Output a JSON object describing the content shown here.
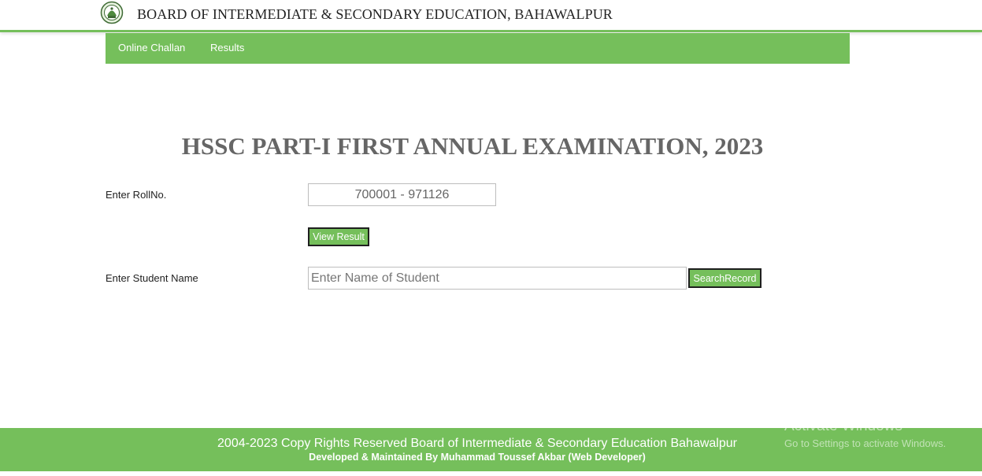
{
  "header": {
    "board_name": "BOARD OF INTERMEDIATE & SECONDARY EDUCATION, BAHAWALPUR",
    "logo_icon": "board-seal-icon"
  },
  "nav": {
    "items": [
      {
        "label": "Online Challan"
      },
      {
        "label": "Results"
      }
    ]
  },
  "main": {
    "exam_title": "HSSC PART-I FIRST ANNUAL EXAMINATION, 2023",
    "roll": {
      "label": "Enter RollNo.",
      "placeholder": "700001 - 971126",
      "button_label": "View Result"
    },
    "name_search": {
      "label": "Enter Student Name",
      "placeholder": "Enter Name of Student",
      "button_label": "SearchRecord"
    }
  },
  "footer": {
    "copyright": "2004-2023 Copy Rights Reserved Board of Intermediate & Secondary Education Bahawalpur",
    "developer": "Developed & Maintained By Muhammad Toussef Akbar (Web Developer)"
  },
  "watermark": {
    "title": "Activate Windows",
    "subtitle": "Go to Settings to activate Windows."
  },
  "colors": {
    "accent_green": "#75bf5b",
    "title_gray": "#666666"
  }
}
